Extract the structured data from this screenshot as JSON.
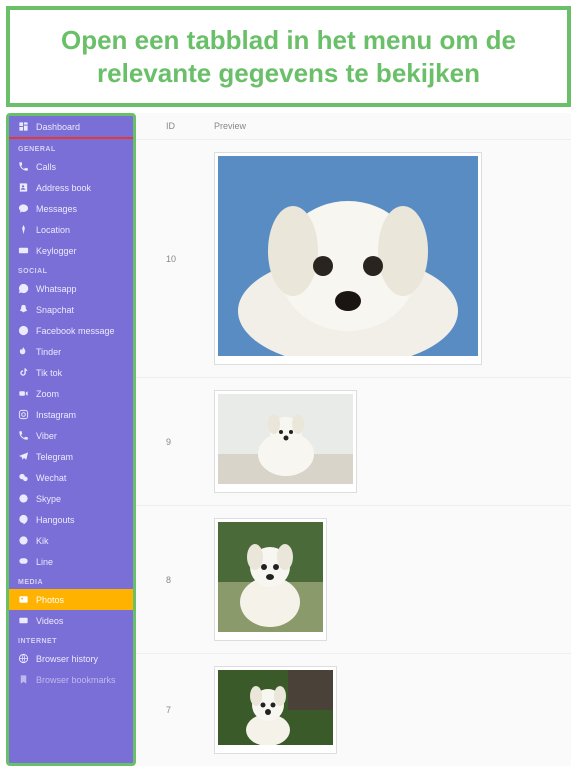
{
  "banner": {
    "text": "Open een tabblad in het menu om de relevante gegevens te bekijken"
  },
  "sidebar": {
    "dashboard": {
      "label": "Dashboard"
    },
    "sections": [
      {
        "title": "GENERAL",
        "items": [
          {
            "label": "Calls",
            "icon": "phone-icon"
          },
          {
            "label": "Address book",
            "icon": "contacts-icon"
          },
          {
            "label": "Messages",
            "icon": "message-icon"
          },
          {
            "label": "Location",
            "icon": "location-icon"
          },
          {
            "label": "Keylogger",
            "icon": "keyboard-icon"
          }
        ]
      },
      {
        "title": "SOCIAL",
        "items": [
          {
            "label": "Whatsapp",
            "icon": "whatsapp-icon"
          },
          {
            "label": "Snapchat",
            "icon": "snapchat-icon"
          },
          {
            "label": "Facebook message",
            "icon": "facebook-icon"
          },
          {
            "label": "Tinder",
            "icon": "tinder-icon"
          },
          {
            "label": "Tik tok",
            "icon": "tiktok-icon"
          },
          {
            "label": "Zoom",
            "icon": "zoom-icon"
          },
          {
            "label": "Instagram",
            "icon": "instagram-icon"
          },
          {
            "label": "Viber",
            "icon": "viber-icon"
          },
          {
            "label": "Telegram",
            "icon": "telegram-icon"
          },
          {
            "label": "Wechat",
            "icon": "wechat-icon"
          },
          {
            "label": "Skype",
            "icon": "skype-icon"
          },
          {
            "label": "Hangouts",
            "icon": "hangouts-icon"
          },
          {
            "label": "Kik",
            "icon": "kik-icon"
          },
          {
            "label": "Line",
            "icon": "line-icon"
          }
        ]
      },
      {
        "title": "MEDIA",
        "items": [
          {
            "label": "Photos",
            "icon": "photos-icon",
            "active": true
          },
          {
            "label": "Videos",
            "icon": "videos-icon"
          }
        ]
      },
      {
        "title": "INTERNET",
        "items": [
          {
            "label": "Browser history",
            "icon": "globe-icon"
          },
          {
            "label": "Browser bookmarks",
            "icon": "bookmark-icon"
          }
        ]
      }
    ]
  },
  "main": {
    "columns": {
      "id": "ID",
      "preview": "Preview"
    },
    "rows": [
      {
        "id": "10"
      },
      {
        "id": "9"
      },
      {
        "id": "8"
      },
      {
        "id": "7"
      }
    ]
  }
}
